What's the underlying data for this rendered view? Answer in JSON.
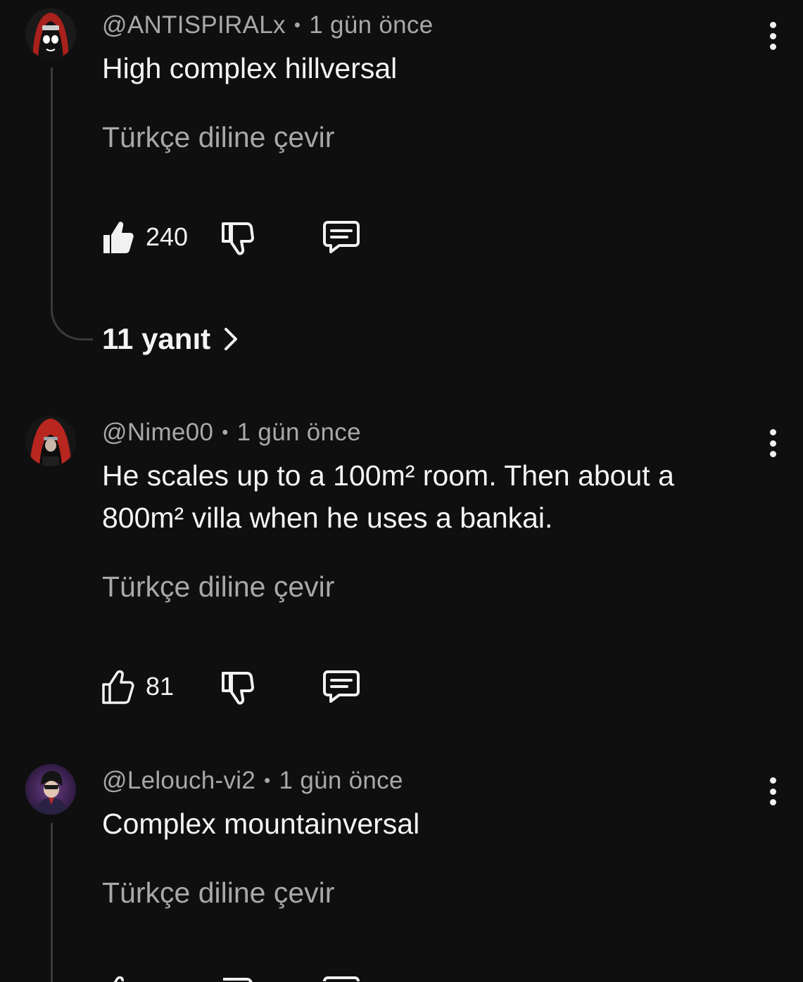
{
  "comments": [
    {
      "author": "@ANTISPIRALx",
      "time": "1 gün önce",
      "text": "High complex hillversal",
      "translate": "Türkçe diline çevir",
      "likes": "240",
      "liked": true,
      "replies_label": "11 yanıt"
    },
    {
      "author": "@Nime00",
      "time": "1 gün önce",
      "text": "He scales up to a 100m² room. Then about a 800m² villa when he uses a bankai.",
      "translate": "Türkçe diline çevir",
      "likes": "81",
      "liked": false
    },
    {
      "author": "@Lelouch-vi2",
      "time": "1 gün önce",
      "text": "Complex mountainversal",
      "translate": "Türkçe diline çevir"
    }
  ],
  "separator": "•",
  "icons": {
    "like": "thumbs-up-icon",
    "dislike": "thumbs-down-icon",
    "reply": "comment-icon",
    "menu": "more-vertical-icon",
    "replies_arrow": "chevron-right-icon"
  }
}
